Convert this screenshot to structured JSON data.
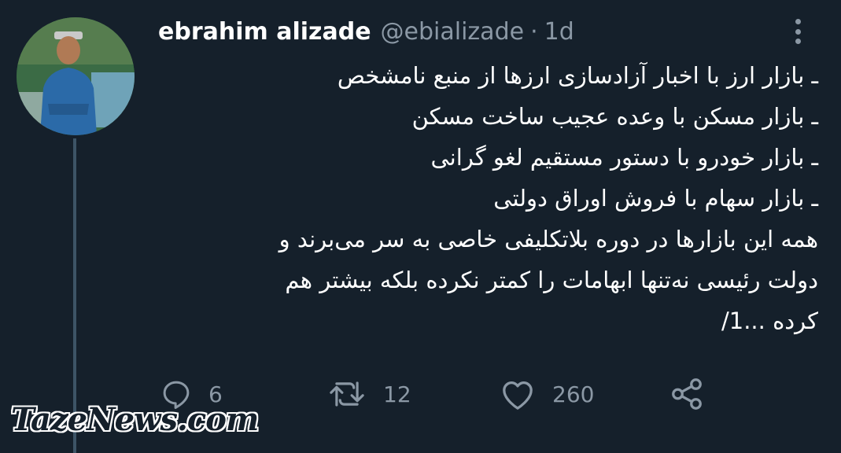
{
  "tweet": {
    "author_name": "ebrahim alizade",
    "handle": "@ebializade",
    "separator": "·",
    "time": "1d",
    "lines": [
      "ـ بازار ارز با اخبار آزادسازی ارزها از منبع نامشخص",
      "ـ بازار مسکن با وعده عجیب ساخت مسکن",
      "ـ بازار خودرو با دستور مستقیم لغو گرانی",
      "ـ بازار سهام با فروش اوراق دولتی",
      "همه این بازارها در دوره بلاتکلیفی خاصی به سر می‌برند و",
      "دولت رئیسی نه‌تنها ابهامات را کمتر نکرده بلکه بیشتر هم",
      "کرده ...1/"
    ]
  },
  "actions": {
    "reply_count": "6",
    "retweet_count": "12",
    "like_count": "260"
  },
  "icons": {
    "more": "more-vertical-icon",
    "reply": "reply-icon",
    "retweet": "retweet-icon",
    "like": "heart-icon",
    "share": "share-icon"
  },
  "watermark": "TazeNews.com",
  "colors": {
    "background": "#15202b",
    "text": "#ffffff",
    "muted": "#8b98a5",
    "thread_line": "#3d5466"
  }
}
